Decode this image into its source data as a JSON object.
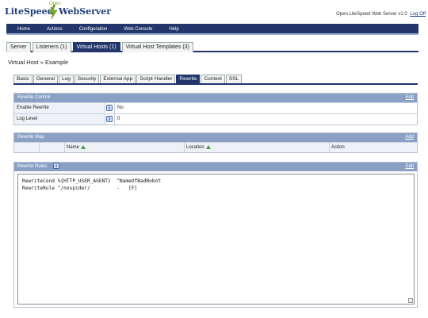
{
  "logo": {
    "open": "Open",
    "brand_left": "LiteSpeed",
    "brand_right": "WebServer"
  },
  "server_info": {
    "text": "Open LiteSpeed Web Server v1.0",
    "logoff": "Log Off"
  },
  "menu": {
    "items": [
      "Home",
      "Actions",
      "Configuration",
      "Web Console",
      "Help"
    ]
  },
  "subtabs": [
    "Server",
    "Listeners (1)",
    "Virtual Hosts (1)",
    "Virtual Host Templates (3)"
  ],
  "subtab_active": "Virtual Hosts (1)",
  "page_title": "Virtual Host » Example",
  "vhost_tabs": [
    "Basic",
    "General",
    "Log",
    "Security",
    "External App",
    "Script Handler",
    "Rewrite",
    "Context",
    "SSL"
  ],
  "vhost_tab_active": "Rewrite",
  "rewrite_control": {
    "title": "Rewrite Control",
    "edit": "Edit",
    "rows": [
      {
        "label": "Enable Rewrite",
        "value": "No"
      },
      {
        "label": "Log Level",
        "value": "0"
      }
    ]
  },
  "rewrite_map": {
    "title": "Rewrite Map",
    "add": "Add",
    "columns": {
      "name": "Name",
      "location": "Location",
      "action": "Action"
    }
  },
  "rewrite_rules": {
    "title": "Rewrite Rules",
    "edit": "Edit",
    "content": "RewriteCond %{HTTP_USER_AGENT}  ^NameOfBadRobot\nRewriteRule ^/nospider/         -   [F]"
  },
  "colors": {
    "nav": "#22366b",
    "section_header": "#8aa0c4",
    "logo_green": "#7bb02c"
  }
}
